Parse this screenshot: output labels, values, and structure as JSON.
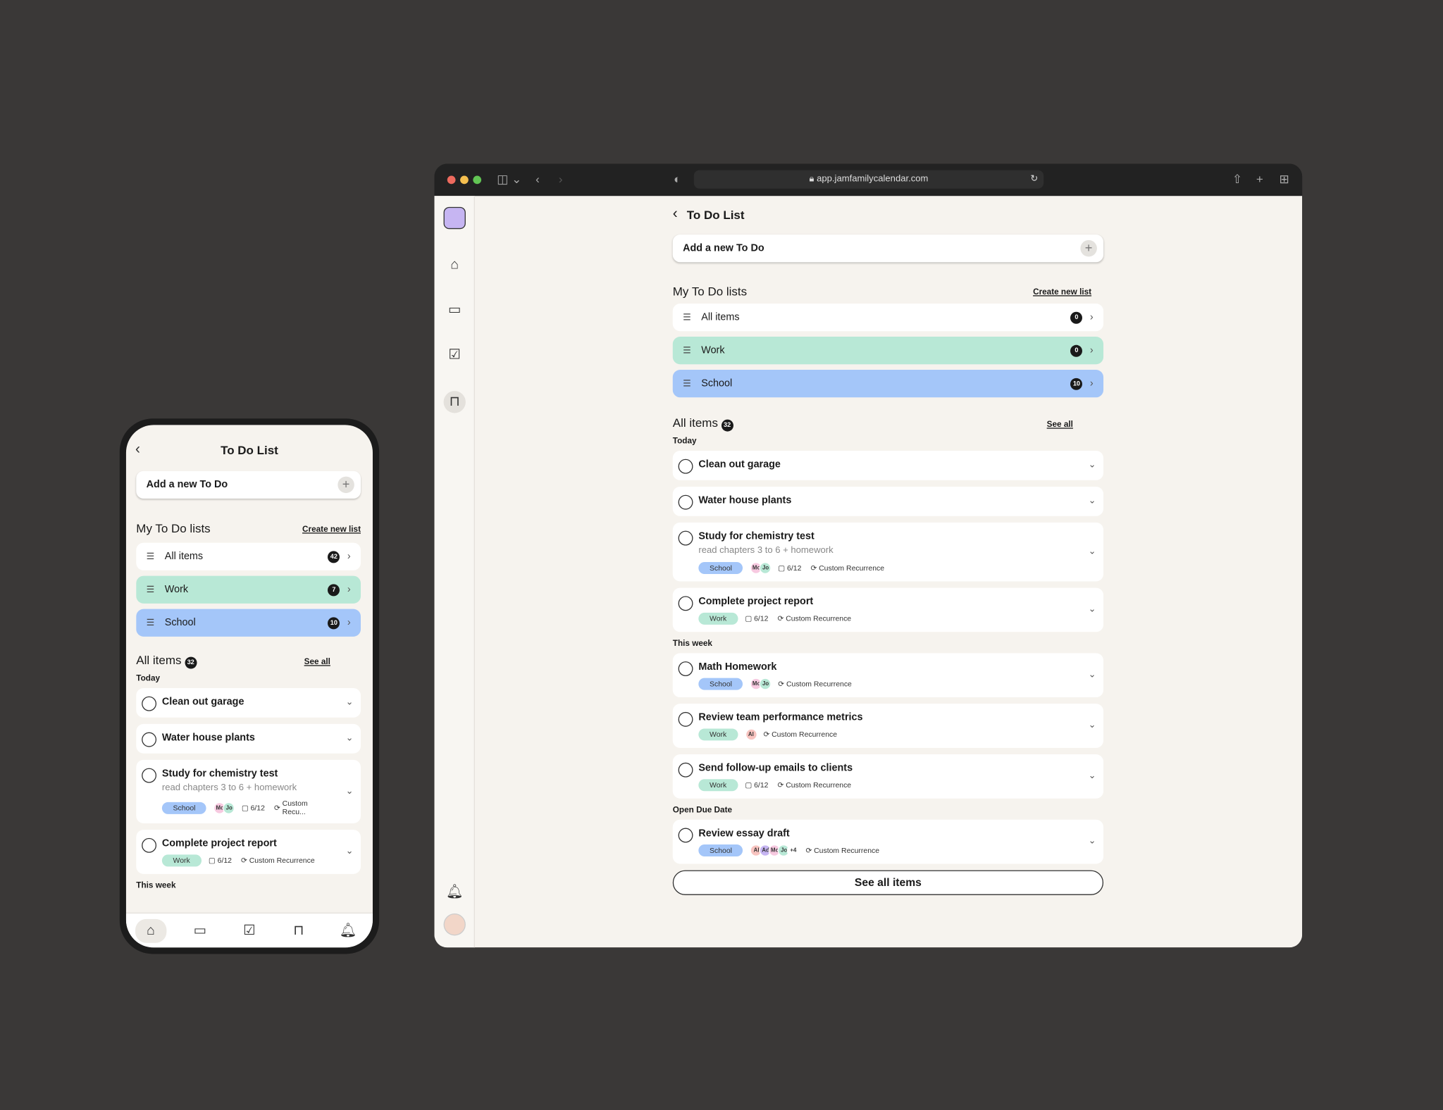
{
  "browser": {
    "url": "app.jamfamilycalendar.com",
    "traffic": [
      "#ed6a5e",
      "#f5bf4f",
      "#62c554"
    ]
  },
  "page": {
    "title": "To Do List",
    "add_placeholder": "Add a new To Do",
    "lists_heading": "My To Do lists",
    "create_list": "Create new list",
    "all_items_heading": "All items",
    "all_items_count": "32",
    "see_all": "See all",
    "see_all_items": "See all items"
  },
  "desktop_lists": [
    {
      "name": "All items",
      "count": "0"
    },
    {
      "name": "Work",
      "count": "0"
    },
    {
      "name": "School",
      "count": "10"
    }
  ],
  "phone_lists": [
    {
      "name": "All items",
      "count": "42"
    },
    {
      "name": "Work",
      "count": "7"
    },
    {
      "name": "School",
      "count": "10"
    }
  ],
  "sections": {
    "today": "Today",
    "this_week": "This week",
    "open": "Open Due Date"
  },
  "items": [
    {
      "title": "Clean out garage"
    },
    {
      "title": "Water house plants"
    },
    {
      "title": "Study for chemistry test",
      "sub": "read chapters 3 to 6 + homework",
      "tag": "School",
      "avatars": [
        "Mo",
        "Jo"
      ],
      "progress": "6/12",
      "recur": "Custom Recurrence",
      "recur_short": "Custom Recu..."
    },
    {
      "title": "Complete project report",
      "tag": "Work",
      "progress": "6/12",
      "recur": "Custom Recurrence"
    },
    {
      "title": "Math Homework",
      "tag": "School",
      "avatars": [
        "Mo",
        "Jo"
      ],
      "recur": "Custom Recurrence"
    },
    {
      "title": "Review team performance metrics",
      "tag": "Work",
      "avatars": [
        "Al"
      ],
      "recur": "Custom Recurrence"
    },
    {
      "title": "Send follow-up emails to clients",
      "tag": "Work",
      "progress": "6/12",
      "recur": "Custom Recurrence"
    },
    {
      "title": "Review essay draft",
      "tag": "School",
      "avatars": [
        "Al",
        "Ad",
        "Mo",
        "Jo",
        "+4"
      ],
      "recur": "Custom Recurrence"
    }
  ],
  "colors": {
    "work": "#b8e8d6",
    "school": "#a4c6f9"
  }
}
